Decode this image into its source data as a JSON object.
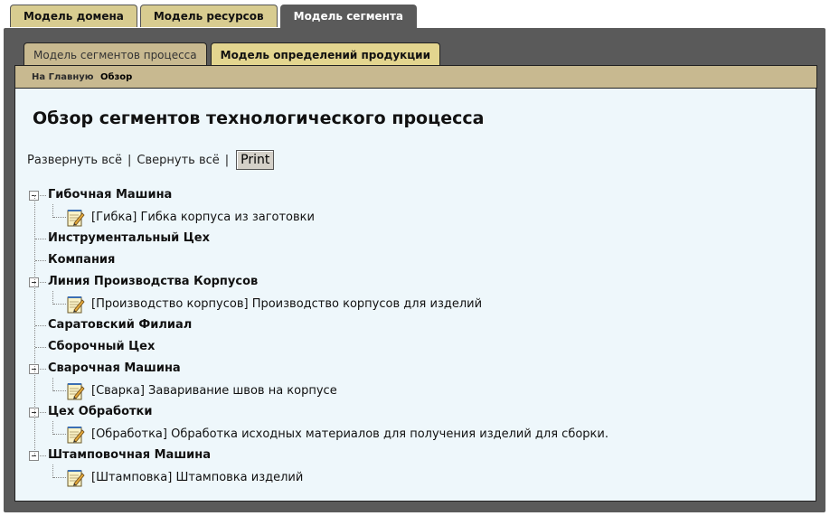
{
  "top_tabs": [
    {
      "label": "Модель домена",
      "active": false
    },
    {
      "label": "Модель ресурсов",
      "active": false
    },
    {
      "label": "Модель сегмента",
      "active": true
    }
  ],
  "sub_tabs": [
    {
      "label": "Модель сегментов процесса",
      "active": true
    },
    {
      "label": "Модель определений продукции",
      "active": false
    }
  ],
  "breadcrumb": {
    "home": "На Главную",
    "current": "Обзор"
  },
  "page_title": "Обзор сегментов технологического процесса",
  "actions": {
    "expand_all": "Развернуть всё",
    "collapse_all": "Свернуть всё",
    "separator": "|",
    "print": "Print"
  },
  "tree": [
    {
      "label": "Гибочная Машина",
      "expanded": true,
      "children": [
        {
          "label": "[Гибка] Гибка корпуса из заготовки",
          "icon": "notepad-pencil-icon"
        }
      ]
    },
    {
      "label": "Инструментальный Цех",
      "expanded": false,
      "children": []
    },
    {
      "label": "Компания",
      "expanded": false,
      "children": []
    },
    {
      "label": "Линия Производства Корпусов",
      "expanded": true,
      "children": [
        {
          "label": "[Производство корпусов] Производство корпусов для изделий",
          "icon": "notepad-pencil-icon"
        }
      ]
    },
    {
      "label": "Саратовский Филиал",
      "expanded": false,
      "children": []
    },
    {
      "label": "Сборочный Цех",
      "expanded": false,
      "children": []
    },
    {
      "label": "Сварочная Машина",
      "expanded": true,
      "children": [
        {
          "label": "[Сварка] Заваривание швов на корпусе",
          "icon": "notepad-pencil-icon"
        }
      ]
    },
    {
      "label": "Цех Обработки",
      "expanded": true,
      "children": [
        {
          "label": "[Обработка] Обработка исходных материалов для получения изделий для сборки.",
          "icon": "notepad-pencil-icon"
        }
      ]
    },
    {
      "label": "Штамповочная Машина",
      "expanded": true,
      "children": [
        {
          "label": "[Штамповка] Штамповка изделий",
          "icon": "notepad-pencil-icon"
        }
      ]
    }
  ],
  "colors": {
    "frame": "#5a5a5a",
    "tab_gold": "#d8cc90",
    "crumb_bar": "#c8b990",
    "panel": "#eef7fb"
  }
}
